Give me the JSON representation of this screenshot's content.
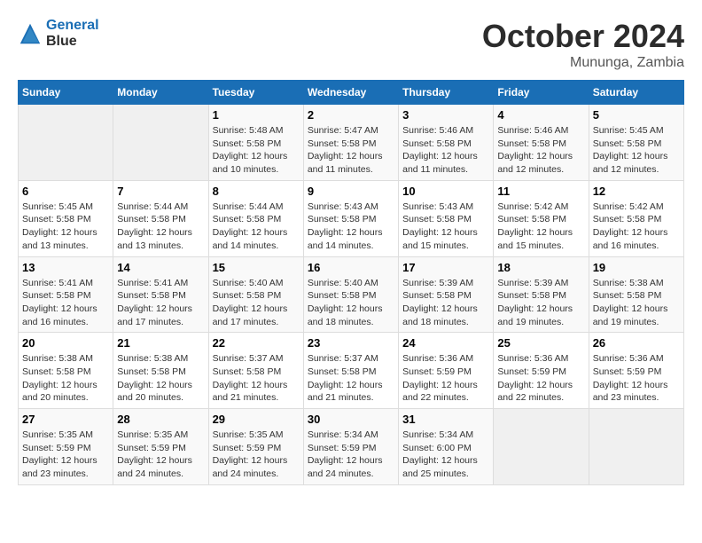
{
  "header": {
    "logo_line1": "General",
    "logo_line2": "Blue",
    "month": "October 2024",
    "location": "Mununga, Zambia"
  },
  "weekdays": [
    "Sunday",
    "Monday",
    "Tuesday",
    "Wednesday",
    "Thursday",
    "Friday",
    "Saturday"
  ],
  "weeks": [
    [
      {
        "day": "",
        "sunrise": "",
        "sunset": "",
        "daylight": ""
      },
      {
        "day": "",
        "sunrise": "",
        "sunset": "",
        "daylight": ""
      },
      {
        "day": "1",
        "sunrise": "Sunrise: 5:48 AM",
        "sunset": "Sunset: 5:58 PM",
        "daylight": "Daylight: 12 hours and 10 minutes."
      },
      {
        "day": "2",
        "sunrise": "Sunrise: 5:47 AM",
        "sunset": "Sunset: 5:58 PM",
        "daylight": "Daylight: 12 hours and 11 minutes."
      },
      {
        "day": "3",
        "sunrise": "Sunrise: 5:46 AM",
        "sunset": "Sunset: 5:58 PM",
        "daylight": "Daylight: 12 hours and 11 minutes."
      },
      {
        "day": "4",
        "sunrise": "Sunrise: 5:46 AM",
        "sunset": "Sunset: 5:58 PM",
        "daylight": "Daylight: 12 hours and 12 minutes."
      },
      {
        "day": "5",
        "sunrise": "Sunrise: 5:45 AM",
        "sunset": "Sunset: 5:58 PM",
        "daylight": "Daylight: 12 hours and 12 minutes."
      }
    ],
    [
      {
        "day": "6",
        "sunrise": "Sunrise: 5:45 AM",
        "sunset": "Sunset: 5:58 PM",
        "daylight": "Daylight: 12 hours and 13 minutes."
      },
      {
        "day": "7",
        "sunrise": "Sunrise: 5:44 AM",
        "sunset": "Sunset: 5:58 PM",
        "daylight": "Daylight: 12 hours and 13 minutes."
      },
      {
        "day": "8",
        "sunrise": "Sunrise: 5:44 AM",
        "sunset": "Sunset: 5:58 PM",
        "daylight": "Daylight: 12 hours and 14 minutes."
      },
      {
        "day": "9",
        "sunrise": "Sunrise: 5:43 AM",
        "sunset": "Sunset: 5:58 PM",
        "daylight": "Daylight: 12 hours and 14 minutes."
      },
      {
        "day": "10",
        "sunrise": "Sunrise: 5:43 AM",
        "sunset": "Sunset: 5:58 PM",
        "daylight": "Daylight: 12 hours and 15 minutes."
      },
      {
        "day": "11",
        "sunrise": "Sunrise: 5:42 AM",
        "sunset": "Sunset: 5:58 PM",
        "daylight": "Daylight: 12 hours and 15 minutes."
      },
      {
        "day": "12",
        "sunrise": "Sunrise: 5:42 AM",
        "sunset": "Sunset: 5:58 PM",
        "daylight": "Daylight: 12 hours and 16 minutes."
      }
    ],
    [
      {
        "day": "13",
        "sunrise": "Sunrise: 5:41 AM",
        "sunset": "Sunset: 5:58 PM",
        "daylight": "Daylight: 12 hours and 16 minutes."
      },
      {
        "day": "14",
        "sunrise": "Sunrise: 5:41 AM",
        "sunset": "Sunset: 5:58 PM",
        "daylight": "Daylight: 12 hours and 17 minutes."
      },
      {
        "day": "15",
        "sunrise": "Sunrise: 5:40 AM",
        "sunset": "Sunset: 5:58 PM",
        "daylight": "Daylight: 12 hours and 17 minutes."
      },
      {
        "day": "16",
        "sunrise": "Sunrise: 5:40 AM",
        "sunset": "Sunset: 5:58 PM",
        "daylight": "Daylight: 12 hours and 18 minutes."
      },
      {
        "day": "17",
        "sunrise": "Sunrise: 5:39 AM",
        "sunset": "Sunset: 5:58 PM",
        "daylight": "Daylight: 12 hours and 18 minutes."
      },
      {
        "day": "18",
        "sunrise": "Sunrise: 5:39 AM",
        "sunset": "Sunset: 5:58 PM",
        "daylight": "Daylight: 12 hours and 19 minutes."
      },
      {
        "day": "19",
        "sunrise": "Sunrise: 5:38 AM",
        "sunset": "Sunset: 5:58 PM",
        "daylight": "Daylight: 12 hours and 19 minutes."
      }
    ],
    [
      {
        "day": "20",
        "sunrise": "Sunrise: 5:38 AM",
        "sunset": "Sunset: 5:58 PM",
        "daylight": "Daylight: 12 hours and 20 minutes."
      },
      {
        "day": "21",
        "sunrise": "Sunrise: 5:38 AM",
        "sunset": "Sunset: 5:58 PM",
        "daylight": "Daylight: 12 hours and 20 minutes."
      },
      {
        "day": "22",
        "sunrise": "Sunrise: 5:37 AM",
        "sunset": "Sunset: 5:58 PM",
        "daylight": "Daylight: 12 hours and 21 minutes."
      },
      {
        "day": "23",
        "sunrise": "Sunrise: 5:37 AM",
        "sunset": "Sunset: 5:58 PM",
        "daylight": "Daylight: 12 hours and 21 minutes."
      },
      {
        "day": "24",
        "sunrise": "Sunrise: 5:36 AM",
        "sunset": "Sunset: 5:59 PM",
        "daylight": "Daylight: 12 hours and 22 minutes."
      },
      {
        "day": "25",
        "sunrise": "Sunrise: 5:36 AM",
        "sunset": "Sunset: 5:59 PM",
        "daylight": "Daylight: 12 hours and 22 minutes."
      },
      {
        "day": "26",
        "sunrise": "Sunrise: 5:36 AM",
        "sunset": "Sunset: 5:59 PM",
        "daylight": "Daylight: 12 hours and 23 minutes."
      }
    ],
    [
      {
        "day": "27",
        "sunrise": "Sunrise: 5:35 AM",
        "sunset": "Sunset: 5:59 PM",
        "daylight": "Daylight: 12 hours and 23 minutes."
      },
      {
        "day": "28",
        "sunrise": "Sunrise: 5:35 AM",
        "sunset": "Sunset: 5:59 PM",
        "daylight": "Daylight: 12 hours and 24 minutes."
      },
      {
        "day": "29",
        "sunrise": "Sunrise: 5:35 AM",
        "sunset": "Sunset: 5:59 PM",
        "daylight": "Daylight: 12 hours and 24 minutes."
      },
      {
        "day": "30",
        "sunrise": "Sunrise: 5:34 AM",
        "sunset": "Sunset: 5:59 PM",
        "daylight": "Daylight: 12 hours and 24 minutes."
      },
      {
        "day": "31",
        "sunrise": "Sunrise: 5:34 AM",
        "sunset": "Sunset: 6:00 PM",
        "daylight": "Daylight: 12 hours and 25 minutes."
      },
      {
        "day": "",
        "sunrise": "",
        "sunset": "",
        "daylight": ""
      },
      {
        "day": "",
        "sunrise": "",
        "sunset": "",
        "daylight": ""
      }
    ]
  ]
}
